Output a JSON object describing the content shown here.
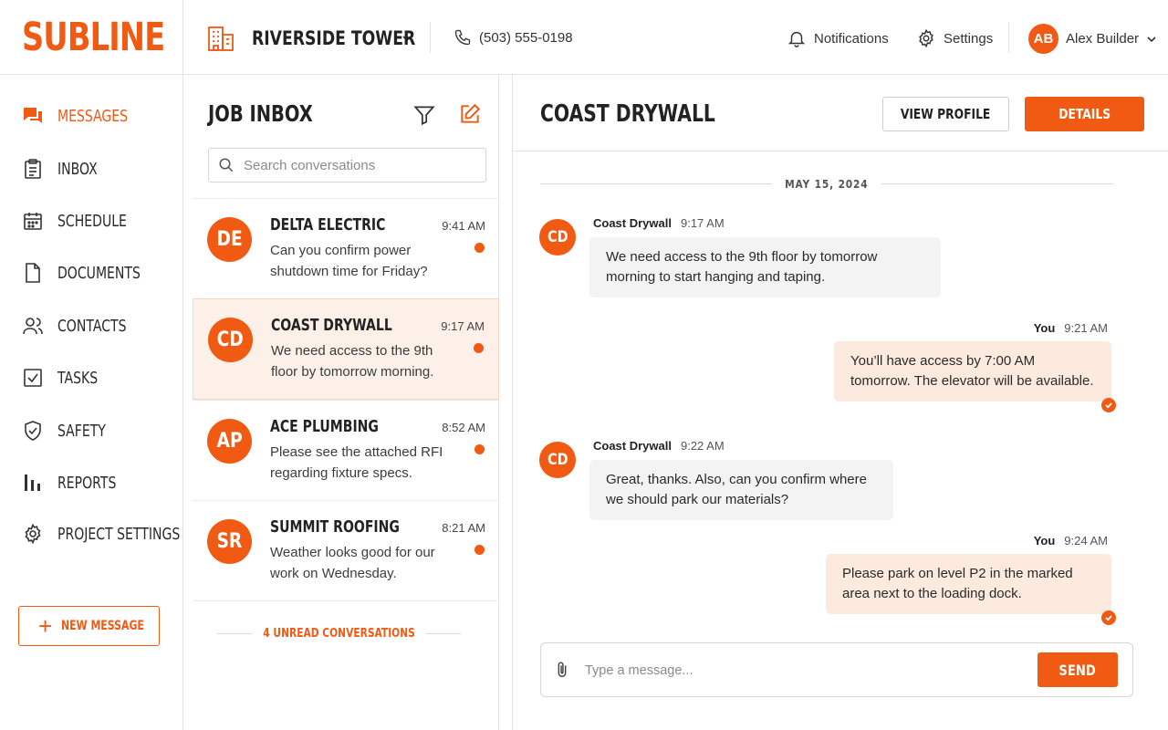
{
  "brand": {
    "logo": "SUBLINE",
    "accent_color": "#f05a12"
  },
  "header": {
    "project_name": "RIVERSIDE TOWER",
    "phone": "(503) 555-0198",
    "notifications_label": "Notifications",
    "settings_label": "Settings",
    "user_initials": "AB",
    "user_name": "Alex Builder"
  },
  "sidebar": {
    "items": [
      {
        "label": "Messages",
        "icon": "chat-bubbles-icon",
        "active": true
      },
      {
        "label": "Inbox",
        "icon": "clipboard-icon"
      },
      {
        "label": "Schedule",
        "icon": "calendar-icon"
      },
      {
        "label": "Documents",
        "icon": "document-icon"
      },
      {
        "label": "Contacts",
        "icon": "users-icon"
      },
      {
        "label": "Tasks",
        "icon": "checkbox-icon"
      },
      {
        "label": "Safety",
        "icon": "shield-check-icon"
      },
      {
        "label": "Reports",
        "icon": "bar-chart-icon"
      },
      {
        "label": "Project Settings",
        "icon": "gear-icon"
      }
    ],
    "new_message_label": "NEW MESSAGE"
  },
  "inbox": {
    "title": "JOB INBOX",
    "search_placeholder": "Search conversations",
    "conversations": [
      {
        "initials": "DE",
        "name": "DELTA ELECTRIC",
        "time": "9:41 AM",
        "preview": "Can you confirm power shutdown time for Friday?",
        "unread": true
      },
      {
        "initials": "CD",
        "name": "COAST DRYWALL",
        "time": "9:17 AM",
        "preview": "We need access to the 9th floor by tomorrow morning.",
        "unread": true,
        "active": true
      },
      {
        "initials": "AP",
        "name": "ACE PLUMBING",
        "time": "8:52 AM",
        "preview": "Please see the attached RFI regarding fixture specs.",
        "unread": true
      },
      {
        "initials": "SR",
        "name": "SUMMIT ROOFING",
        "time": "8:21 AM",
        "preview": "Weather looks good for our work on Wednesday.",
        "unread": true
      }
    ],
    "unread_summary": "4 UNREAD CONVERSATIONS"
  },
  "chat": {
    "title": "COAST DRYWALL",
    "view_profile_label": "VIEW PROFILE",
    "details_label": "DETAILS",
    "date_divider": "MAY 15, 2024",
    "messages": [
      {
        "from": "Coast Drywall",
        "initials": "CD",
        "time": "9:17 AM",
        "text": "We need access to the 9th floor by tomorrow morning to start hanging and taping.",
        "outgoing": false
      },
      {
        "from": "You",
        "time": "9:21 AM",
        "text": "You’ll have access by 7:00 AM tomorrow. The elevator will be available.",
        "outgoing": true
      },
      {
        "from": "Coast Drywall",
        "initials": "CD",
        "time": "9:22 AM",
        "text": "Great, thanks. Also, can you confirm where we should park our materials?",
        "outgoing": false
      },
      {
        "from": "You",
        "time": "9:24 AM",
        "text": "Please park on level P2 in the marked area next to the loading dock.",
        "outgoing": true
      }
    ],
    "composer_placeholder": "Type a message...",
    "send_label": "SEND"
  }
}
